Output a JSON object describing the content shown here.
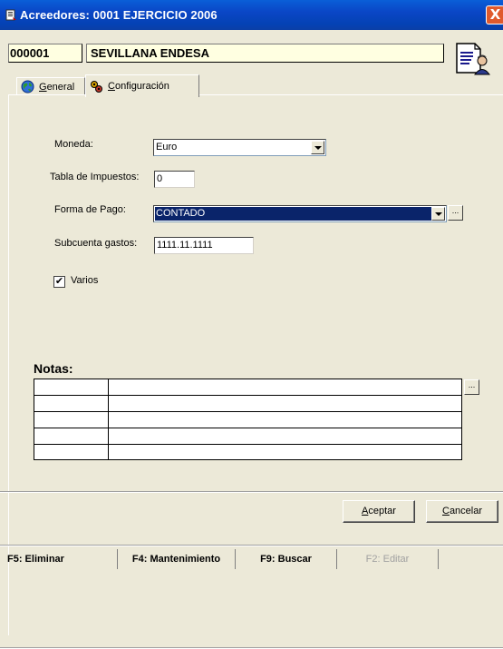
{
  "window": {
    "title": "Acreedores: 0001 EJERCICIO 2006",
    "close_label": "X"
  },
  "header": {
    "code": "000001",
    "name": "SEVILLANA ENDESA"
  },
  "tabs": [
    {
      "label_underline": "G",
      "label_rest": "eneral",
      "icon": "globe-icon",
      "active": false
    },
    {
      "label_underline": "C",
      "label_rest": "onfiguración",
      "icon": "gears-icon",
      "active": true
    }
  ],
  "form": {
    "moneda_label": "Moneda:",
    "moneda_value": "Euro",
    "tabla_label": "Tabla de Impuestos:",
    "tabla_value": "0",
    "forma_pago_label": "Forma de Pago:",
    "forma_pago_value": "CONTADO",
    "subcuenta_label": "Subcuenta gastos:",
    "subcuenta_value": "1111.11.1111",
    "varios_label": "Varios",
    "varios_checked": true,
    "dots_label": "..."
  },
  "notas": {
    "label": "Notas:",
    "rows": 5,
    "dots_label": "..."
  },
  "buttons": {
    "aceptar_underline": "A",
    "aceptar_rest": "ceptar",
    "cancelar_underline": "C",
    "cancelar_rest": "ancelar"
  },
  "function_keys": [
    {
      "label": "F5: Eliminar",
      "enabled": true
    },
    {
      "label": "F4: Mantenimiento",
      "enabled": true
    },
    {
      "label": "F9: Buscar",
      "enabled": true
    },
    {
      "label": "F2: Editar",
      "enabled": false
    }
  ],
  "colors": {
    "titlebar": "#0a46c6",
    "window_bg": "#ece9d8",
    "selection": "#0a246a",
    "highlight_field": "#ffffe1"
  }
}
